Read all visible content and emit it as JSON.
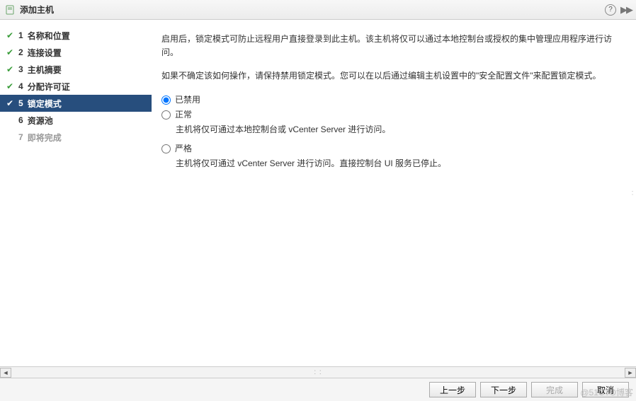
{
  "header": {
    "title": "添加主机"
  },
  "sidebar": {
    "steps": [
      {
        "num": "1",
        "label": "名称和位置",
        "state": "completed"
      },
      {
        "num": "2",
        "label": "连接设置",
        "state": "completed"
      },
      {
        "num": "3",
        "label": "主机摘要",
        "state": "completed"
      },
      {
        "num": "4",
        "label": "分配许可证",
        "state": "completed"
      },
      {
        "num": "5",
        "label": "锁定模式",
        "state": "active"
      },
      {
        "num": "6",
        "label": "资源池",
        "state": "pending"
      },
      {
        "num": "7",
        "label": "即将完成",
        "state": "disabled"
      }
    ]
  },
  "content": {
    "para1": "启用后，锁定模式可防止远程用户直接登录到此主机。该主机将仅可以通过本地控制台或授权的集中管理应用程序进行访问。",
    "para2": "如果不确定该如何操作，请保持禁用锁定模式。您可以在以后通过编辑主机设置中的\"安全配置文件\"来配置锁定模式。",
    "options": [
      {
        "label": "已禁用",
        "desc": "",
        "selected": true
      },
      {
        "label": "正常",
        "desc": "主机将仅可通过本地控制台或 vCenter Server 进行访问。",
        "selected": false
      },
      {
        "label": "严格",
        "desc": "主机将仅可通过 vCenter Server 进行访问。直接控制台 UI 服务已停止。",
        "selected": false
      }
    ]
  },
  "footer": {
    "back": "上一步",
    "next": "下一步",
    "finish": "完成",
    "cancel": "取消"
  },
  "watermark": "@51CTO博客"
}
